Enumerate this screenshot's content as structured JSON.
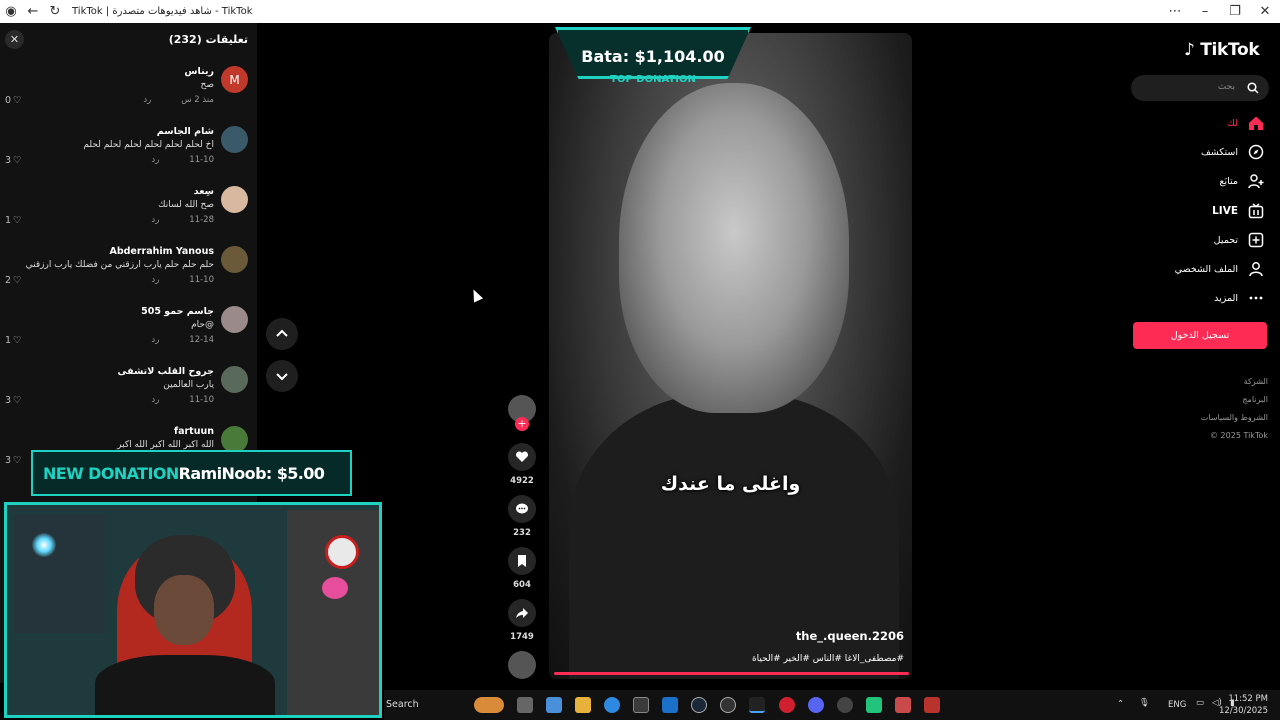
{
  "browser": {
    "title": "TikTok | شاهد فيديوهات متصدرة - TikTok"
  },
  "comments_panel": {
    "title": "تعليقات (232)",
    "items": [
      {
        "avatar_letter": "M",
        "avatar_color": "#c0392b",
        "name": "ريناس",
        "text": "صح",
        "date": "منذ 2 س",
        "reply": "رد",
        "likes": "0"
      },
      {
        "avatar_letter": "",
        "avatar_color": "#3a5a6a",
        "name": "شام الجاسم",
        "text": "اخ لحلم لحلم لحلم لحلم لحلم لحلم",
        "date": "11-10",
        "reply": "رد",
        "likes": "3"
      },
      {
        "avatar_letter": "",
        "avatar_color": "#d9b8a0",
        "name": "سِعد",
        "text": "صح الله لسانك",
        "date": "11-28",
        "reply": "رد",
        "likes": "1"
      },
      {
        "avatar_letter": "",
        "avatar_color": "#6a5a3a",
        "name": "Abderrahim Yanous",
        "text": "حلم حلم حلم يارب ارزقني من فضلك يارب ارزقني",
        "date": "11-10",
        "reply": "رد",
        "likes": "2"
      },
      {
        "avatar_letter": "",
        "avatar_color": "#9a8a8a",
        "name": "جاسم حمو 505",
        "text": "@حام",
        "date": "12-14",
        "reply": "رد",
        "likes": "1"
      },
      {
        "avatar_letter": "",
        "avatar_color": "#5a6a5a",
        "name": "جروح القلب لاتشفى",
        "text": "يارب العالمين",
        "date": "11-10",
        "reply": "رد",
        "likes": "3"
      },
      {
        "avatar_letter": "",
        "avatar_color": "#4a7a3a",
        "name": "fartuun",
        "text": "الله اكبر الله اكبر الله اكبر",
        "date": "",
        "reply": "",
        "likes": "3"
      }
    ]
  },
  "video": {
    "subtitle": "واغلى ما عندك",
    "author": "the_.queen.2206",
    "hashtags": "#مصطفى_الاغا #الناس #الخير #الحياة"
  },
  "top_donation": {
    "amount": "Bata: $1,104.00",
    "label": "TOP DONATION"
  },
  "new_donation": {
    "label": "NEW DONATION",
    "text": "RamiNoob: $5.00"
  },
  "actions": {
    "likes": "4922",
    "comments": "232",
    "saves": "604",
    "shares": "1749"
  },
  "tiktok_sidebar": {
    "logo": "TikTok",
    "search_placeholder": "بحث",
    "nav": [
      {
        "label": "لك",
        "active": true
      },
      {
        "label": "استكشف",
        "active": false
      },
      {
        "label": "متابَع",
        "active": false
      },
      {
        "label": "LIVE",
        "active": false
      },
      {
        "label": "تحميل",
        "active": false
      },
      {
        "label": "الملف الشخصي",
        "active": false
      },
      {
        "label": "المزيد",
        "active": false
      }
    ],
    "login": "تسجيل الدخول",
    "footer": [
      "الشركة",
      "البرنامج",
      "الشروط والسياسات",
      "© 2025 TikTok"
    ]
  },
  "taskbar": {
    "search": "Search",
    "lang": "ENG",
    "time": "11:52 PM",
    "date": "12/30/2025"
  },
  "colors": {
    "accent": "#fe2c55",
    "donation": "#1fd1c1"
  }
}
